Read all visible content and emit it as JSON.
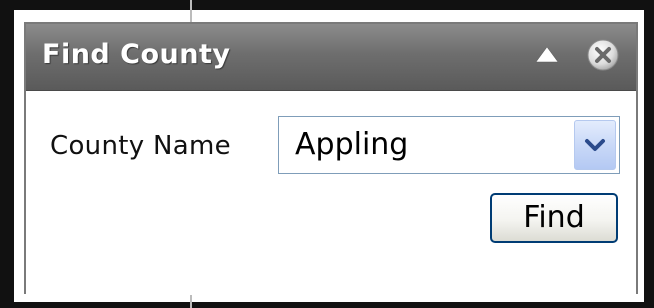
{
  "panel": {
    "title": "Find County",
    "collapse_icon": "triangle-up-icon",
    "close_icon": "close-circle-icon"
  },
  "form": {
    "county_label": "County Name",
    "county_select": {
      "selected_value": "Appling",
      "dropdown_icon": "chevron-down-icon"
    },
    "find_button_label": "Find"
  },
  "colors": {
    "titlebar": "#6e6e6e",
    "title_text": "#ffffff",
    "select_border": "#7f9db9",
    "dropdown_button": "#c7d7f7",
    "button_border": "#003c74"
  }
}
